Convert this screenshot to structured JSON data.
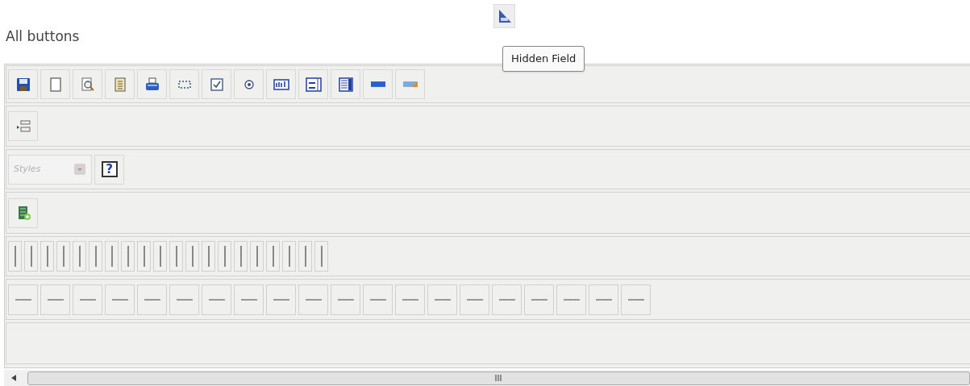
{
  "heading": "All buttons",
  "floating_button": {
    "kind": "hidden-field"
  },
  "tooltip": "Hidden Field",
  "toolbar_rows": [
    {
      "items": [
        {
          "kind": "save"
        },
        {
          "kind": "new-page"
        },
        {
          "kind": "preview"
        },
        {
          "kind": "templates"
        },
        {
          "kind": "print"
        },
        {
          "kind": "form"
        },
        {
          "kind": "checkbox"
        },
        {
          "kind": "radio"
        },
        {
          "kind": "text-field"
        },
        {
          "kind": "textarea"
        },
        {
          "kind": "select"
        },
        {
          "kind": "button"
        },
        {
          "kind": "image-button"
        }
      ]
    },
    {
      "items": [
        {
          "kind": "indent"
        }
      ]
    },
    {
      "items": [
        {
          "kind": "combo",
          "placeholder": "Styles"
        },
        {
          "kind": "help",
          "label": "?"
        }
      ]
    },
    {
      "items": [
        {
          "kind": "media"
        }
      ]
    },
    {
      "items": [
        {
          "kind": "vsep"
        },
        {
          "kind": "vsep"
        },
        {
          "kind": "vsep"
        },
        {
          "kind": "vsep"
        },
        {
          "kind": "vsep"
        },
        {
          "kind": "vsep"
        },
        {
          "kind": "vsep"
        },
        {
          "kind": "vsep"
        },
        {
          "kind": "vsep"
        },
        {
          "kind": "vsep"
        },
        {
          "kind": "vsep"
        },
        {
          "kind": "vsep"
        },
        {
          "kind": "vsep"
        },
        {
          "kind": "vsep"
        },
        {
          "kind": "vsep"
        },
        {
          "kind": "vsep"
        },
        {
          "kind": "vsep"
        },
        {
          "kind": "vsep"
        },
        {
          "kind": "vsep"
        },
        {
          "kind": "vsep"
        }
      ]
    },
    {
      "items": [
        {
          "kind": "hline"
        },
        {
          "kind": "hline"
        },
        {
          "kind": "hline"
        },
        {
          "kind": "hline"
        },
        {
          "kind": "hline"
        },
        {
          "kind": "hline"
        },
        {
          "kind": "hline"
        },
        {
          "kind": "hline"
        },
        {
          "kind": "hline"
        },
        {
          "kind": "hline"
        },
        {
          "kind": "hline"
        },
        {
          "kind": "hline"
        },
        {
          "kind": "hline"
        },
        {
          "kind": "hline"
        },
        {
          "kind": "hline"
        },
        {
          "kind": "hline"
        },
        {
          "kind": "hline"
        },
        {
          "kind": "hline"
        },
        {
          "kind": "hline"
        },
        {
          "kind": "hline"
        }
      ]
    },
    {
      "kind": "empty"
    }
  ]
}
